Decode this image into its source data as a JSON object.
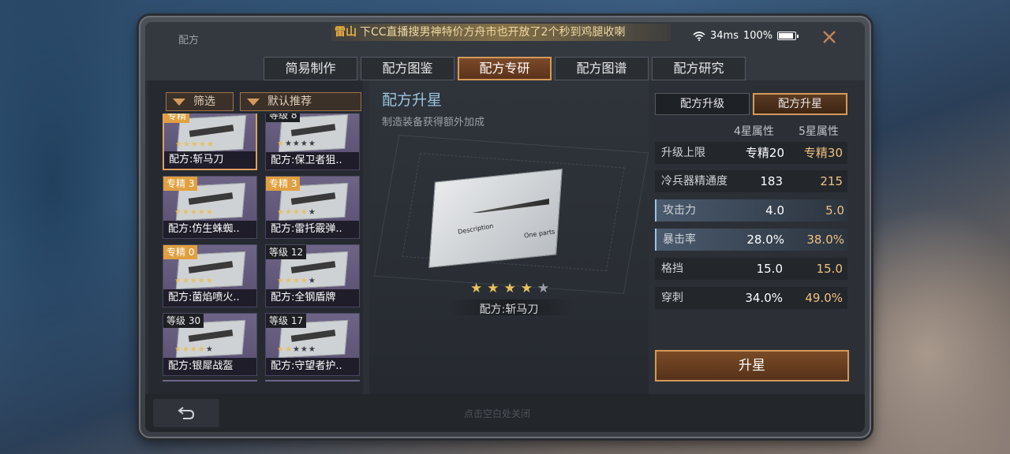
{
  "window": {
    "title": "配方",
    "marquee_tag": "雷山",
    "marquee_text": "下CC直播搜男神特价方舟市也开放了2个秒到鸡腿收喇",
    "ping": "34ms",
    "battery": "100%"
  },
  "tabs": [
    {
      "label": "简易制作"
    },
    {
      "label": "配方图鉴"
    },
    {
      "label": "配方专研"
    },
    {
      "label": "配方图谱"
    },
    {
      "label": "配方研究"
    }
  ],
  "filters": {
    "filter_label": "筛选",
    "sort_label": "默认推荐"
  },
  "cards": [
    {
      "badge": "专精",
      "name": "配方:斩马刀",
      "stars": "★★★★★",
      "stars_off": ""
    },
    {
      "badge": "等级 8",
      "name": "配方:保卫者狙..",
      "stars": "★",
      "stars_off": "★★★★"
    },
    {
      "badge": "专精 3",
      "name": "配方:仿生蛛蜘..",
      "stars": "★★★★★",
      "stars_off": ""
    },
    {
      "badge": "专精 3",
      "name": "配方:雷托霰弹..",
      "stars": "★★★★",
      "stars_off": "★"
    },
    {
      "badge": "专精 0",
      "name": "配方:菌焰喷火..",
      "stars": "★★★★★",
      "stars_off": ""
    },
    {
      "badge": "等级 12",
      "name": "配方:全钢盾牌",
      "stars": "★★★★",
      "stars_off": "★"
    },
    {
      "badge": "等级 30",
      "name": "配方:银犀战盔",
      "stars": "★★★★",
      "stars_off": "★"
    },
    {
      "badge": "等级 17",
      "name": "配方:守望者护..",
      "stars": "★★",
      "stars_off": "★★★"
    }
  ],
  "center": {
    "heading": "配方升星",
    "subheading": "制造装备获得额外加成",
    "paper_text1": "Description",
    "paper_text2": "One parts",
    "stars_on": "★★★★",
    "stars_off": "★",
    "recipe_name": "配方:斩马刀"
  },
  "right": {
    "subtabs": [
      "配方升级",
      "配方升星"
    ],
    "col_4star": "4星属性",
    "col_5star": "5星属性",
    "rows": [
      {
        "label": "升级上限",
        "v4": "专精20",
        "v5": "专精30"
      },
      {
        "label": "冷兵器精通度",
        "v4": "183",
        "v5": "215"
      },
      {
        "label": "攻击力",
        "v4": "4.0",
        "v5": "5.0"
      },
      {
        "label": "暴击率",
        "v4": "28.0%",
        "v5": "38.0%"
      },
      {
        "label": "格挡",
        "v4": "15.0",
        "v5": "15.0"
      },
      {
        "label": "穿刺",
        "v4": "34.0%",
        "v5": "49.0%"
      }
    ],
    "action_label": "升星"
  },
  "footer": {
    "hint": "点击空白处关闭"
  },
  "colors": {
    "accent_gold": "#d49a5a",
    "value_gold": "#f0c080",
    "heading_blue": "#9cc4e0"
  }
}
